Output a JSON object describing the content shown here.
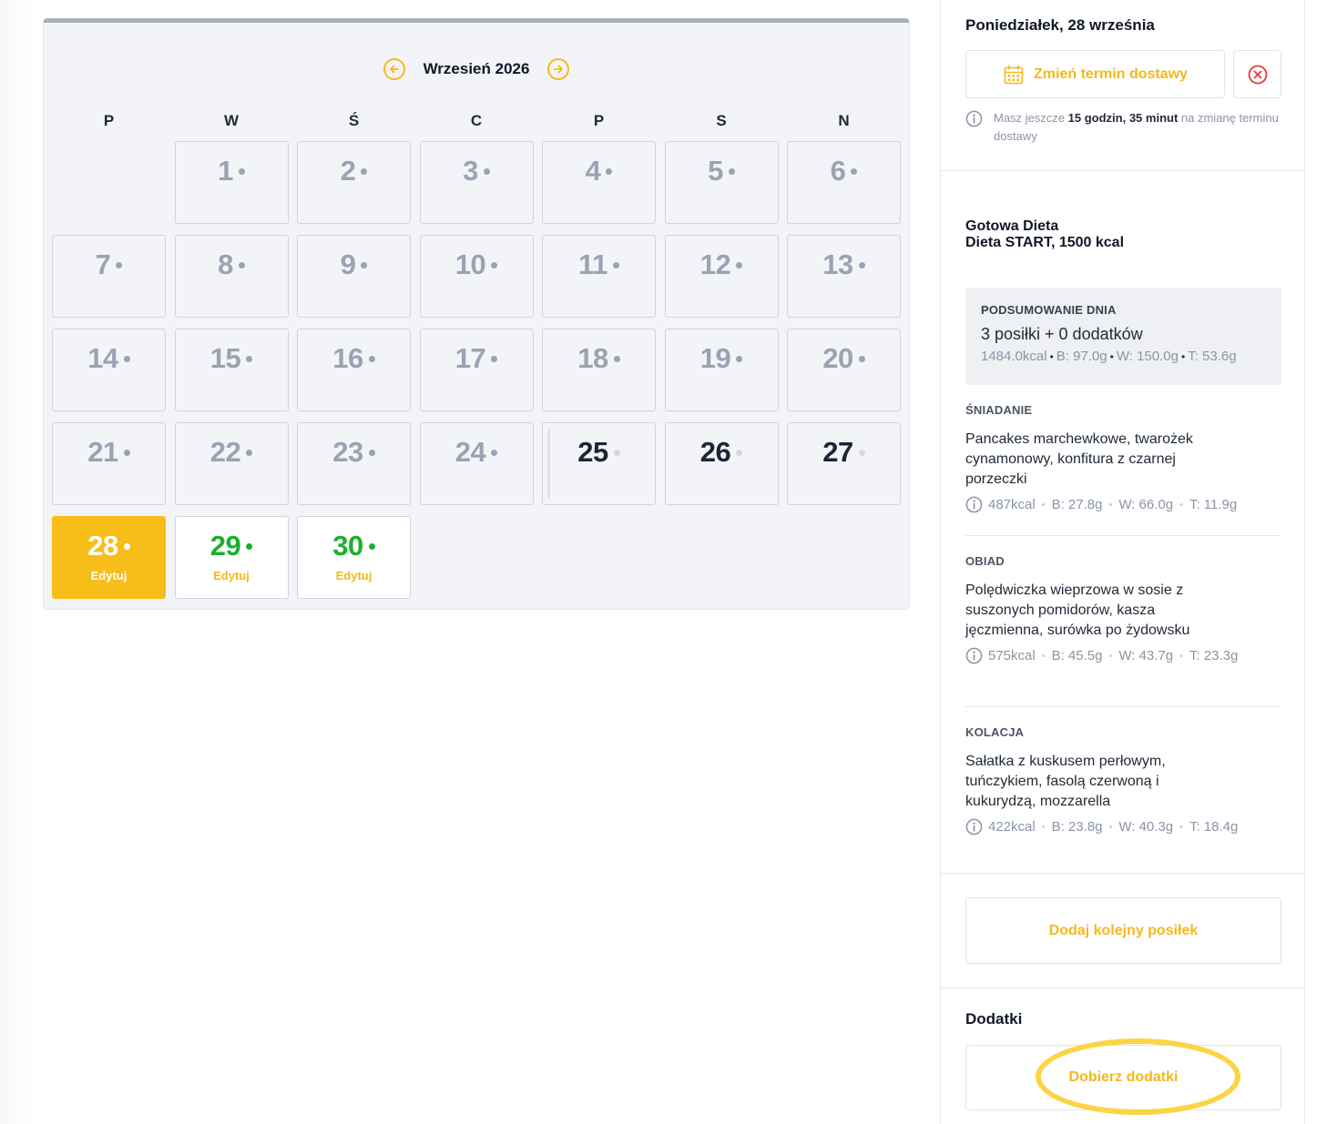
{
  "calendar": {
    "month_title": "Wrzesień 2026",
    "weekdays": [
      "P",
      "W",
      "Ś",
      "C",
      "P",
      "S",
      "N"
    ],
    "edit_label": "Edytuj",
    "days": [
      {
        "num": "1",
        "state": "past"
      },
      {
        "num": "2",
        "state": "past"
      },
      {
        "num": "3",
        "state": "past"
      },
      {
        "num": "4",
        "state": "past"
      },
      {
        "num": "5",
        "state": "past"
      },
      {
        "num": "6",
        "state": "past"
      },
      {
        "num": "7",
        "state": "past"
      },
      {
        "num": "8",
        "state": "past"
      },
      {
        "num": "9",
        "state": "past"
      },
      {
        "num": "10",
        "state": "past"
      },
      {
        "num": "11",
        "state": "past"
      },
      {
        "num": "12",
        "state": "past"
      },
      {
        "num": "13",
        "state": "past"
      },
      {
        "num": "14",
        "state": "past"
      },
      {
        "num": "15",
        "state": "past"
      },
      {
        "num": "16",
        "state": "past"
      },
      {
        "num": "17",
        "state": "past"
      },
      {
        "num": "18",
        "state": "past"
      },
      {
        "num": "19",
        "state": "past"
      },
      {
        "num": "20",
        "state": "past"
      },
      {
        "num": "21",
        "state": "past"
      },
      {
        "num": "22",
        "state": "past"
      },
      {
        "num": "23",
        "state": "past"
      },
      {
        "num": "24",
        "state": "past"
      },
      {
        "num": "25",
        "state": "active"
      },
      {
        "num": "26",
        "state": "active"
      },
      {
        "num": "27",
        "state": "active"
      },
      {
        "num": "28",
        "state": "selected"
      },
      {
        "num": "29",
        "state": "future"
      },
      {
        "num": "30",
        "state": "future"
      }
    ]
  },
  "panel": {
    "date_title": "Poniedziałek, 28 września",
    "change_button": "Zmień termin dostawy",
    "deadline": {
      "prefix": "Masz jeszcze",
      "time": "15 godzin, 35 minut",
      "suffix": "na zmianę terminu dostawy"
    },
    "diet_line1": "Gotowa Dieta",
    "diet_line2": "Dieta START, 1500 kcal",
    "summary": {
      "label": "PODSUMOWANIE DNIA",
      "count": "3 posiłki + 0 dodatków",
      "kcal": "1484.0kcal",
      "b": "B: 97.0g",
      "w": "W: 150.0g",
      "t": "T: 53.6g"
    },
    "meals": [
      {
        "label": "ŚNIADANIE",
        "desc": "Pancakes marchewkowe, twarożek cynamonowy, konfitura z czarnej porzeczki",
        "kcal": "487kcal",
        "b": "B: 27.8g",
        "w": "W: 66.0g",
        "t": "T: 11.9g"
      },
      {
        "label": "OBIAD",
        "desc": "Polędwiczka wieprzowa w sosie z suszonych pomidorów, kasza jęczmienna, surówka po żydowsku",
        "kcal": "575kcal",
        "b": "B: 45.5g",
        "w": "W: 43.7g",
        "t": "T: 23.3g"
      },
      {
        "label": "KOLACJA",
        "desc": "Sałatka z kuskusem perłowym, tuńczykiem, fasolą czerwoną i kukurydzą, mozzarella",
        "kcal": "422kcal",
        "b": "B: 23.8g",
        "w": "W: 40.3g",
        "t": "T: 18.4g"
      }
    ],
    "add_meal_button": "Dodaj kolejny posiłek",
    "addons_title": "Dodatki",
    "addons_button": "Dobierz dodatki"
  },
  "colors": {
    "accent": "#f5b81c",
    "green": "#1bb02c",
    "muted": "#9aa3b2",
    "dark": "#1c2437"
  },
  "icons": {
    "prev": "arrow-left-circle-icon",
    "next": "arrow-right-circle-icon",
    "calendar": "calendar-icon",
    "cancel": "close-circle-icon",
    "info": "info-icon"
  }
}
